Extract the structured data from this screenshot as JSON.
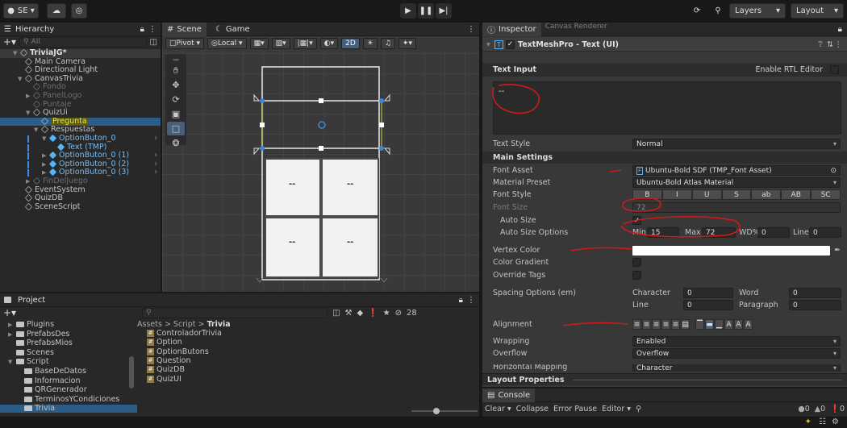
{
  "toolbar": {
    "account": "SE ▾",
    "play_icon": "play-icon",
    "pause_icon": "pause-icon",
    "step_icon": "step-icon",
    "layers": "Layers",
    "layout": "Layout"
  },
  "hierarchy": {
    "title": "Hierarchy",
    "search_placeholder": "All",
    "rows": [
      {
        "label": "TriviaJG*",
        "indent": 0,
        "style": "scene"
      },
      {
        "label": "Main Camera",
        "indent": 1,
        "style": "normal"
      },
      {
        "label": "Directional Light",
        "indent": 1,
        "style": "normal"
      },
      {
        "label": "CanvasTrivia",
        "indent": 1,
        "style": "normal"
      },
      {
        "label": "Fondo",
        "indent": 2,
        "style": "dim"
      },
      {
        "label": "PanelLogo",
        "indent": 2,
        "style": "dim"
      },
      {
        "label": "Puntaje",
        "indent": 2,
        "style": "dim"
      },
      {
        "label": "QuizUi",
        "indent": 2,
        "style": "normal"
      },
      {
        "label": "Pregunta",
        "indent": 3,
        "style": "selected"
      },
      {
        "label": "Respuestas",
        "indent": 3,
        "style": "normal"
      },
      {
        "label": "OptionButon_0",
        "indent": 4,
        "style": "blue"
      },
      {
        "label": "Text (TMP)",
        "indent": 5,
        "style": "blue"
      },
      {
        "label": "OptionButon_0 (1)",
        "indent": 4,
        "style": "blue"
      },
      {
        "label": "OptionButon_0 (2)",
        "indent": 4,
        "style": "blue"
      },
      {
        "label": "OptionButon_0 (3)",
        "indent": 4,
        "style": "blue"
      },
      {
        "label": "FinDelJuego",
        "indent": 2,
        "style": "dim"
      },
      {
        "label": "EventSystem",
        "indent": 1,
        "style": "normal"
      },
      {
        "label": "QuizDB",
        "indent": 1,
        "style": "normal"
      },
      {
        "label": "SceneScript",
        "indent": 1,
        "style": "normal"
      }
    ]
  },
  "scene": {
    "tab_scene": "Scene",
    "tab_game": "Game",
    "pivot": "Pivot",
    "local": "Local",
    "mode_2d": "2D",
    "canvas_text": "--",
    "answer_texts": [
      "--",
      "--",
      "--",
      "--"
    ]
  },
  "inspector": {
    "title": "Inspector",
    "prev_component": "Canvas Renderer",
    "component": "TextMeshPro - Text (UI)",
    "text_input_label": "Text Input",
    "enable_rtl": "Enable RTL Editor",
    "text_value": "--",
    "text_style_label": "Text Style",
    "text_style": "Normal",
    "main_settings": "Main Settings",
    "font_asset_label": "Font Asset",
    "font_asset": "Ubuntu-Bold SDF (TMP_Font Asset)",
    "material_preset_label": "Material Preset",
    "material_preset": "Ubuntu-Bold Atlas Material",
    "font_style_label": "Font Style",
    "font_styles": [
      "B",
      "I",
      "U",
      "S",
      "ab",
      "AB",
      "SC"
    ],
    "font_size_label": "Font Size",
    "font_size": "72",
    "auto_size_label": "Auto Size",
    "auto_size_check": "✓",
    "auto_size_options_label": "Auto Size Options",
    "min_label": "Min",
    "min": "15",
    "max_label": "Max",
    "max": "72",
    "wd_label": "WD%",
    "wd": "0",
    "line_label": "Line",
    "line": "0",
    "vertex_color_label": "Vertex Color",
    "color_gradient_label": "Color Gradient",
    "override_tags_label": "Override Tags",
    "spacing_label": "Spacing Options (em)",
    "character_label": "Character",
    "character": "0",
    "word_label": "Word",
    "word": "0",
    "line_sp_label": "Line",
    "line_sp": "0",
    "paragraph_label": "Paragraph",
    "paragraph": "0",
    "alignment_label": "Alignment",
    "wrapping_label": "Wrapping",
    "wrapping": "Enabled",
    "overflow_label": "Overflow",
    "overflow": "Overflow",
    "hmap_label": "Horizontal Mapping",
    "hmap": "Character",
    "layout_properties": "Layout Properties"
  },
  "project": {
    "title": "Project",
    "count": "28",
    "breadcrumb": [
      "Assets",
      "Script",
      "Trivia"
    ],
    "tree": [
      {
        "label": "Plugins",
        "indent": 1
      },
      {
        "label": "PrefabsDes",
        "indent": 1
      },
      {
        "label": "PrefabsMios",
        "indent": 1
      },
      {
        "label": "Scenes",
        "indent": 1
      },
      {
        "label": "Script",
        "indent": 1
      },
      {
        "label": "BaseDeDatos",
        "indent": 2
      },
      {
        "label": "Informacion",
        "indent": 2
      },
      {
        "label": "QRGenerador",
        "indent": 2
      },
      {
        "label": "TerminosYCondiciones",
        "indent": 2
      },
      {
        "label": "Trivia",
        "indent": 2
      }
    ],
    "files": [
      "ControladorTrivia",
      "Option",
      "OptionButons",
      "Question",
      "QuizDB",
      "QuizUI"
    ]
  },
  "console": {
    "title": "Console",
    "clear": "Clear",
    "collapse": "Collapse",
    "error_pause": "Error Pause",
    "editor": "Editor",
    "info_count": "0",
    "warn_count": "0",
    "error_count": "0"
  }
}
